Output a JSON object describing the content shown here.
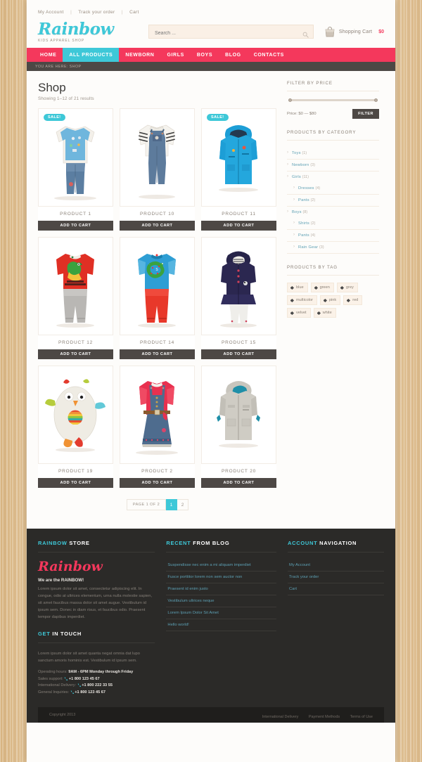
{
  "topbar": {
    "links": [
      "My Account",
      "Track your order",
      "Cart"
    ],
    "separator": "|"
  },
  "header": {
    "logo": "Rainbow",
    "logo_sub": "KIDS APPAREL SHOP",
    "search_placeholder": "Search ...",
    "search_value": "",
    "search_icon": "search-icon",
    "cart_icon": "shopping-bag-icon",
    "cart_label": "Shopping Cart",
    "cart_total": "$0"
  },
  "nav": {
    "items": [
      {
        "label": "HOME",
        "active": false
      },
      {
        "label": "ALL PRODUCTS",
        "active": true
      },
      {
        "label": "NEWBORN",
        "active": false
      },
      {
        "label": "GIRLS",
        "active": false
      },
      {
        "label": "BOYS",
        "active": false
      },
      {
        "label": "BLOG",
        "active": false
      },
      {
        "label": "CONTACTS",
        "active": false
      }
    ],
    "breadcrumb": "YOU ARE HERE: SHOP"
  },
  "main": {
    "title": "Shop",
    "results": "Showing 1–12 of 21 results",
    "add_to_cart_label": "ADD TO CART",
    "sale_label": "SALE!",
    "products": [
      {
        "name": "PRODUCT 1",
        "sale": true,
        "art": "blue-tee-jeans"
      },
      {
        "name": "PRODUCT 10",
        "sale": false,
        "art": "denim-overall-stripe"
      },
      {
        "name": "PRODUCT 11",
        "sale": true,
        "art": "blue-hood-jacket"
      },
      {
        "name": "PRODUCT 12",
        "sale": false,
        "art": "red-croc-tee-grey-pants"
      },
      {
        "name": "PRODUCT 14",
        "sale": false,
        "art": "blue-snake-tee-red-pants"
      },
      {
        "name": "PRODUCT 15",
        "sale": false,
        "art": "navy-velvet-hood-white-pants"
      },
      {
        "name": "PRODUCT 19",
        "sale": false,
        "art": "owl-plush-toy"
      },
      {
        "name": "PRODUCT 2",
        "sale": false,
        "art": "denim-pinafore-red-top"
      },
      {
        "name": "PRODUCT 20",
        "sale": false,
        "art": "grey-hood-jacket"
      }
    ],
    "pagination": {
      "info": "PAGE 1 OF 2",
      "pages": [
        "1",
        "2"
      ],
      "current": "1"
    }
  },
  "sidebar": {
    "filter_price": {
      "title": "FILTER BY PRICE",
      "price_text": "Price: $0 — $80",
      "button": "FILTER"
    },
    "categories": {
      "title": "PRODUCTS BY CATEGORY",
      "items": [
        {
          "label": "Toys",
          "count": "(1)",
          "level": 0
        },
        {
          "label": "Newborn",
          "count": "(3)",
          "level": 0
        },
        {
          "label": "Girls",
          "count": "(11)",
          "level": 0
        },
        {
          "label": "Dresses",
          "count": "(4)",
          "level": 1
        },
        {
          "label": "Pants",
          "count": "(2)",
          "level": 1
        },
        {
          "label": "Boys",
          "count": "(8)",
          "level": 0
        },
        {
          "label": "Shirts",
          "count": "(2)",
          "level": 1
        },
        {
          "label": "Pants",
          "count": "(4)",
          "level": 1
        },
        {
          "label": "Rain Gear",
          "count": "(3)",
          "level": 1
        }
      ]
    },
    "tags": {
      "title": "PRODUCTS BY TAG",
      "icon": "tag-icon",
      "items": [
        "blue",
        "green",
        "grey",
        "multicolor",
        "pink",
        "red",
        "velvet",
        "white"
      ]
    }
  },
  "footer": {
    "col1": {
      "head_accent": "RAINBOW",
      "head_rest": " STORE",
      "logo": "Rainbow",
      "bold": "We are the RAINBOW!",
      "text": "Lorem ipsum dolor sit amet, consectetur adipiscing elit. In congue, odio at ultrices elementum, urna nulla molestie sapien, sit amet faucibus massa dolor sit amet augue. Vestibulum id ipsum sem. Donec in diam risus, et faucibus odio. Praesent tempor dapibus imperdiet."
    },
    "contact": {
      "head_accent": "GET",
      "head_rest": " IN TOUCH",
      "text": "Lorem ipsum dolor sit amet quanta negat omnia dat lupo sanctum amoris hominis est. Vestibulum id ipsum sem.",
      "rows": [
        {
          "label": "Operating hours:",
          "value": "9AM - 6PM Monday through Friday",
          "phone": false
        },
        {
          "label": "Sales support:",
          "value": "+1 800 123 45 67",
          "phone": true
        },
        {
          "label": "International Delivery:",
          "value": "+1 800 222 33 55",
          "phone": true
        },
        {
          "label": "General Inquiries:",
          "value": "+1 800 123 45 67",
          "phone": true
        }
      ]
    },
    "col2": {
      "head_accent": "RECENT",
      "head_rest": " FROM BLOG",
      "items": [
        "Suspendisse nec enim a mi aliquam imperdiet",
        "Fusce porttitor lorem non sem auctor non",
        "Praesent id enim justo",
        "Vestibulum ultrices neque",
        "Lorem Ipsum Dolor Sit Amet",
        "Hello world!"
      ]
    },
    "col3": {
      "head_accent": "ACCOUNT",
      "head_rest": " NAVIGATION",
      "items": [
        "My Account",
        "Track your order",
        "Cart"
      ]
    },
    "bottom": {
      "copyright": "Copyright 2013",
      "links": [
        "International Delivery",
        "Payment Methods",
        "Terms of Use"
      ]
    }
  },
  "colors": {
    "accent_pink": "#f4385c",
    "accent_cyan": "#3ec8d8",
    "dark": "#4d4845",
    "footer_bg": "#2b2a28"
  }
}
